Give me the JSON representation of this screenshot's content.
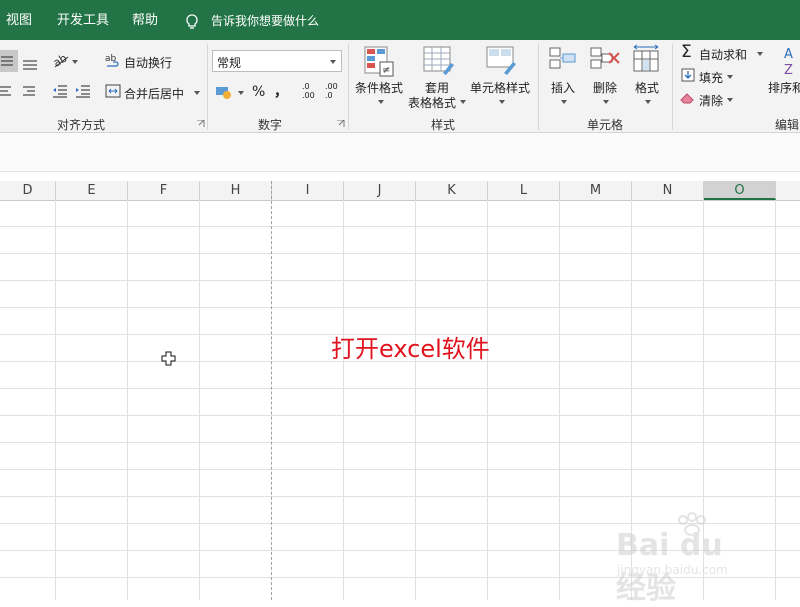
{
  "tabs": [
    "视图",
    "开发工具",
    "帮助"
  ],
  "tell_me": "告诉我你想要做什么",
  "ribbon": {
    "alignment": {
      "wrap_text": "自动换行",
      "merge_center": "合并后居中",
      "group_label": "对齐方式"
    },
    "number": {
      "format_value": "常规",
      "percent_symbol": "%",
      "comma_symbol": "，",
      "increase_decimal": ".0 .00",
      "decrease_decimal": ".00 .0",
      "group_label": "数字"
    },
    "styles": {
      "conditional_formatting": "条件格式",
      "format_as_table_line1": "套用",
      "format_as_table_line2": "表格格式",
      "cell_styles": "单元格样式",
      "group_label": "样式"
    },
    "cells": {
      "insert": "插入",
      "delete": "删除",
      "format": "格式",
      "group_label": "单元格"
    },
    "editing": {
      "autosum": "自动求和",
      "fill": "填充",
      "clear": "清除",
      "sort_filter": "排序和",
      "group_label": "编辑"
    }
  },
  "columns": [
    "D",
    "E",
    "F",
    "H",
    "I",
    "J",
    "K",
    "L",
    "M",
    "N",
    "O"
  ],
  "selected_column": "O",
  "annotation": "打开excel软件",
  "watermark": {
    "line1": "Bai du 经验",
    "line2": "jingyan.baidu.com"
  },
  "colors": {
    "title_bar": "#227447",
    "selected_column_accent": "#217346",
    "annotation_text": "#e0141e"
  }
}
